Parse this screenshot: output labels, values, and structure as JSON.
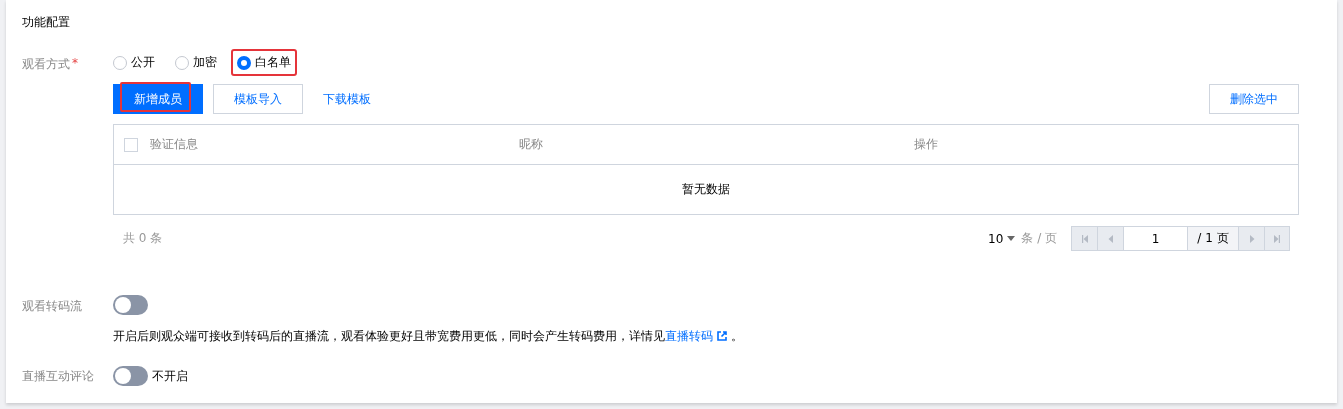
{
  "section_title": "功能配置",
  "view_mode": {
    "label": "观看方式",
    "required_mark": "*",
    "options": [
      {
        "label": "公开",
        "selected": false,
        "highlighted": false
      },
      {
        "label": "加密",
        "selected": false,
        "highlighted": false
      },
      {
        "label": "白名单",
        "selected": true,
        "highlighted": true
      }
    ]
  },
  "toolbar": {
    "buttons": [
      {
        "label": "新增成员",
        "kind": "primary",
        "highlighted": true
      },
      {
        "label": "模板导入",
        "kind": "default",
        "highlighted": false
      },
      {
        "label": "下载模板",
        "kind": "link",
        "highlighted": false
      }
    ],
    "right_button": {
      "label": "删除选中"
    }
  },
  "table": {
    "select_all": {
      "checked": false
    },
    "columns": [
      "验证信息",
      "昵称",
      "操作"
    ],
    "empty_text": "暂无数据"
  },
  "pagination": {
    "total": "共 0 条",
    "page_size": "10",
    "page_size_unit": "条 / 页",
    "page": "1",
    "page_count": "/ 1 页"
  },
  "transcode": {
    "label": "观看转码流",
    "on": false,
    "description": "开启后则观众端可接收到转码后的直播流，观看体验更好且带宽费用更低，同时会产生转码费用，详情见",
    "link": "直播转码",
    "suffix": "。"
  },
  "comments": {
    "label": "直播互动评论",
    "on": false,
    "state_text": "不开启"
  }
}
